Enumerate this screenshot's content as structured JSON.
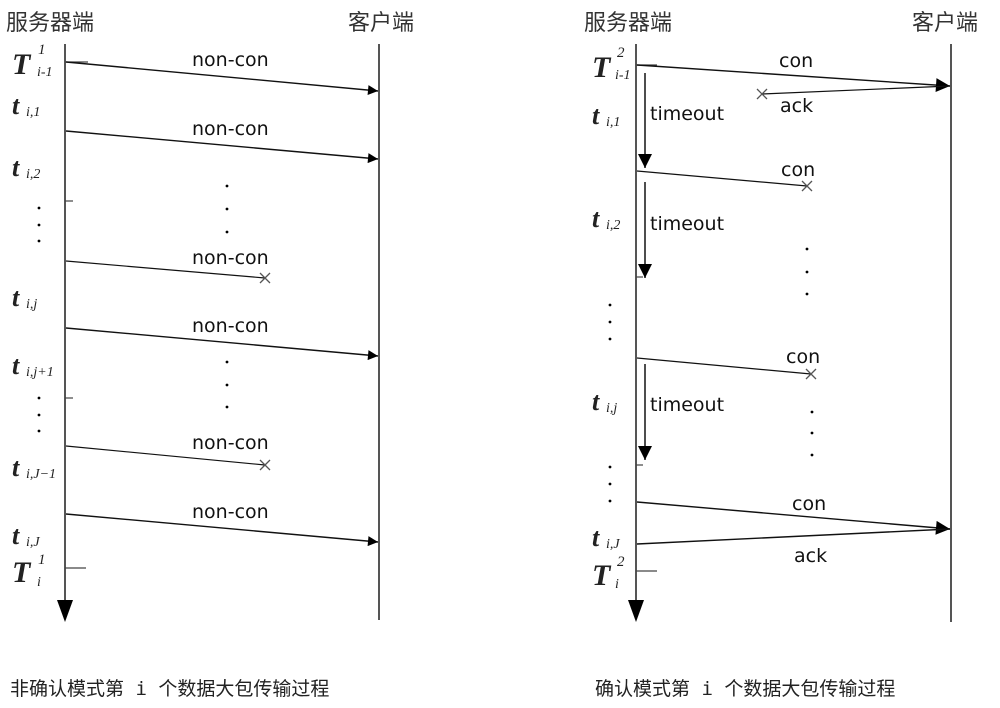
{
  "left": {
    "server_label": "服务器端",
    "client_label": "客户端",
    "caption": "非确认模式第 i 个数据大包传输过程",
    "time_labels": [
      {
        "main": "T",
        "sub": "i-1",
        "sup": "1"
      },
      {
        "main": "t",
        "sub": "i,1",
        "sup": ""
      },
      {
        "main": "t",
        "sub": "i,2",
        "sup": ""
      },
      {
        "main": "t",
        "sub": "i,j",
        "sup": ""
      },
      {
        "main": "t",
        "sub": "i,j+1",
        "sup": ""
      },
      {
        "main": "t",
        "sub": "i,J−1",
        "sup": ""
      },
      {
        "main": "t",
        "sub": "i,J",
        "sup": ""
      },
      {
        "main": "T",
        "sub": "i",
        "sup": "1"
      }
    ],
    "messages": [
      {
        "label": "non-con",
        "delivered": true
      },
      {
        "label": "non-con",
        "delivered": true
      },
      {
        "label": "non-con",
        "delivered": false
      },
      {
        "label": "non-con",
        "delivered": true
      },
      {
        "label": "non-con",
        "delivered": false
      },
      {
        "label": "non-con",
        "delivered": true
      }
    ],
    "ellipsis": "·"
  },
  "right": {
    "server_label": "服务器端",
    "client_label": "客户端",
    "caption": "确认模式第 i 个数据大包传输过程",
    "time_labels": [
      {
        "main": "T",
        "sub": "i-1",
        "sup": "2"
      },
      {
        "main": "t",
        "sub": "i,1",
        "sup": ""
      },
      {
        "main": "t",
        "sub": "i,2",
        "sup": ""
      },
      {
        "main": "t",
        "sub": "i,j",
        "sup": ""
      },
      {
        "main": "t",
        "sub": "i,J",
        "sup": ""
      },
      {
        "main": "T",
        "sub": "i",
        "sup": "2"
      }
    ],
    "messages": [
      {
        "label": "con",
        "delivered": true
      },
      {
        "label": "ack",
        "delivered": false
      },
      {
        "label": "con",
        "delivered": false
      },
      {
        "label": "con",
        "delivered": false
      },
      {
        "label": "con",
        "delivered": true
      },
      {
        "label": "ack",
        "delivered": true
      }
    ],
    "timeout_label": "timeout"
  }
}
